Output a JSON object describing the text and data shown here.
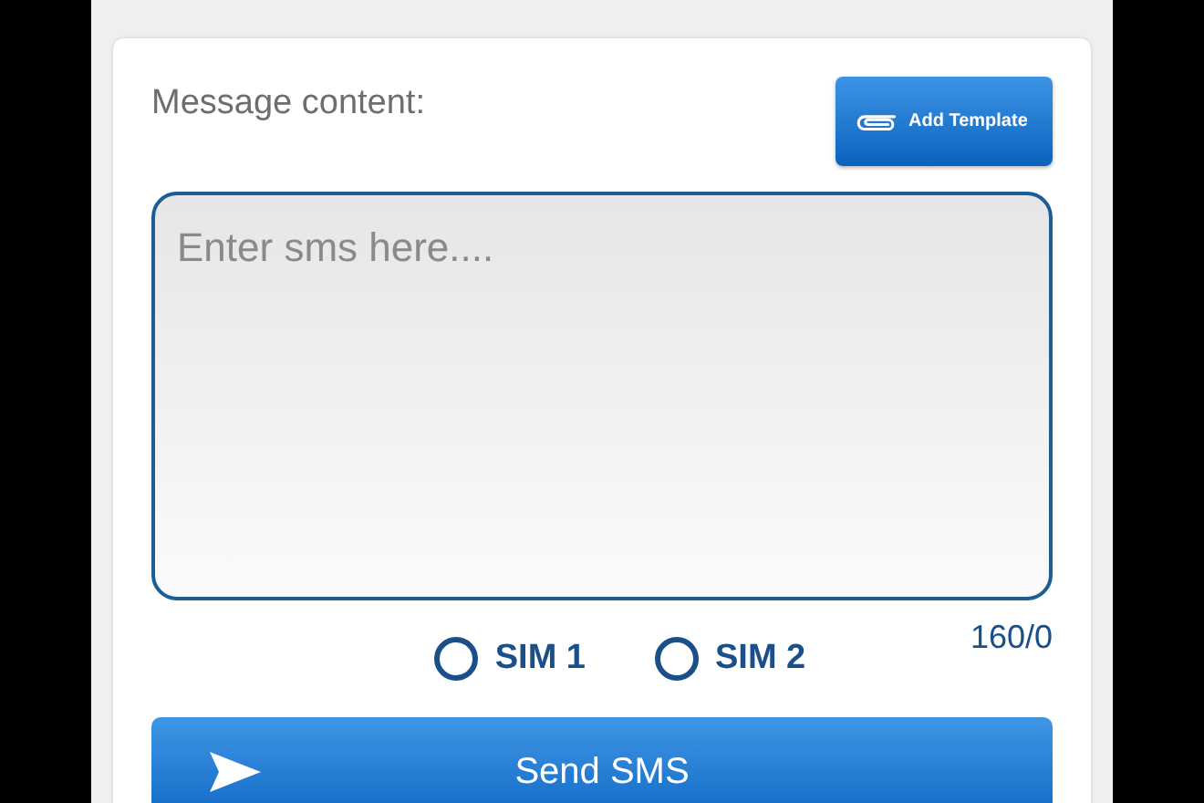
{
  "message": {
    "label": "Message content:",
    "template_button": "Add Template",
    "placeholder": "Enter sms here....",
    "counter": "160/0"
  },
  "sims": [
    {
      "label": "SIM 1",
      "selected": false
    },
    {
      "label": "SIM 2",
      "selected": false
    }
  ],
  "send_button": "Send SMS"
}
